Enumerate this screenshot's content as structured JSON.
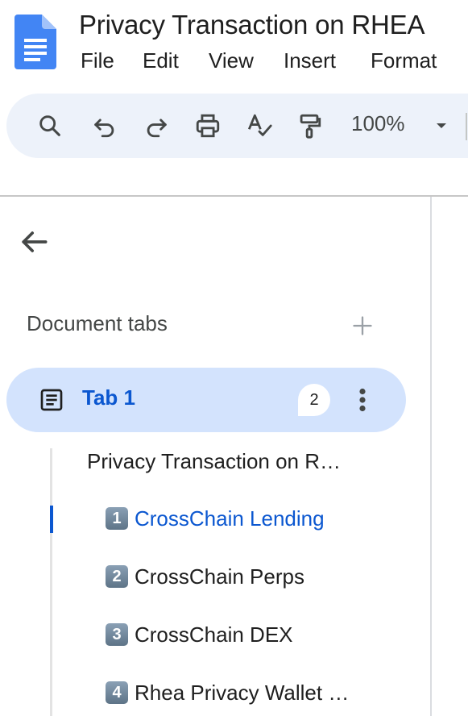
{
  "header": {
    "logo_icon": "google-docs-icon",
    "title": "Privacy Transaction on RHEA"
  },
  "menubar": {
    "items": [
      "File",
      "Edit",
      "View",
      "Insert",
      "Format"
    ]
  },
  "toolbar": {
    "buttons": [
      "search-icon",
      "undo-icon",
      "redo-icon",
      "print-icon",
      "spellcheck-icon",
      "paint-format-icon"
    ],
    "zoom": "100%",
    "zoom_caret_icon": "caret-down-icon"
  },
  "side_panel": {
    "back_icon": "arrow-back-icon",
    "section_title": "Document tabs",
    "add_icon": "plus-icon",
    "tab": {
      "icon": "document-tab-icon",
      "label": "Tab 1",
      "comment_count": "2",
      "more_icon": "more-vert-icon"
    },
    "outline": [
      {
        "text": "Privacy Transaction on R…",
        "keycap": ""
      },
      {
        "text": "CrossChain Lending",
        "keycap": "1"
      },
      {
        "text": "CrossChain Perps",
        "keycap": "2"
      },
      {
        "text": "CrossChain DEX",
        "keycap": "3"
      },
      {
        "text": "Rhea Privacy Wallet …",
        "keycap": "4"
      }
    ],
    "active_outline_index": 1
  },
  "colors": {
    "accent": "#0b57d0",
    "toolbar_bg": "#edf2fa",
    "tab_selected_bg": "#d3e3fd"
  }
}
